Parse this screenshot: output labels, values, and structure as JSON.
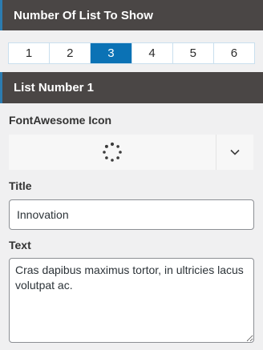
{
  "count_section": {
    "title": "Number Of List To Show",
    "options": [
      "1",
      "2",
      "3",
      "4",
      "5",
      "6"
    ],
    "selected": "3"
  },
  "list_section": {
    "title": "List Number 1",
    "icon_label": "FontAwesome Icon",
    "icon_value": "spinner-icon",
    "title_label": "Title",
    "title_value": "Innovation",
    "text_label": "Text",
    "text_value": "Cras dapibus maximus tortor, in ultricies lacus volutpat ac."
  },
  "colors": {
    "header_bg": "#4a4645",
    "header_accent": "#2c7cb0",
    "active_tab": "#0b72b5"
  }
}
